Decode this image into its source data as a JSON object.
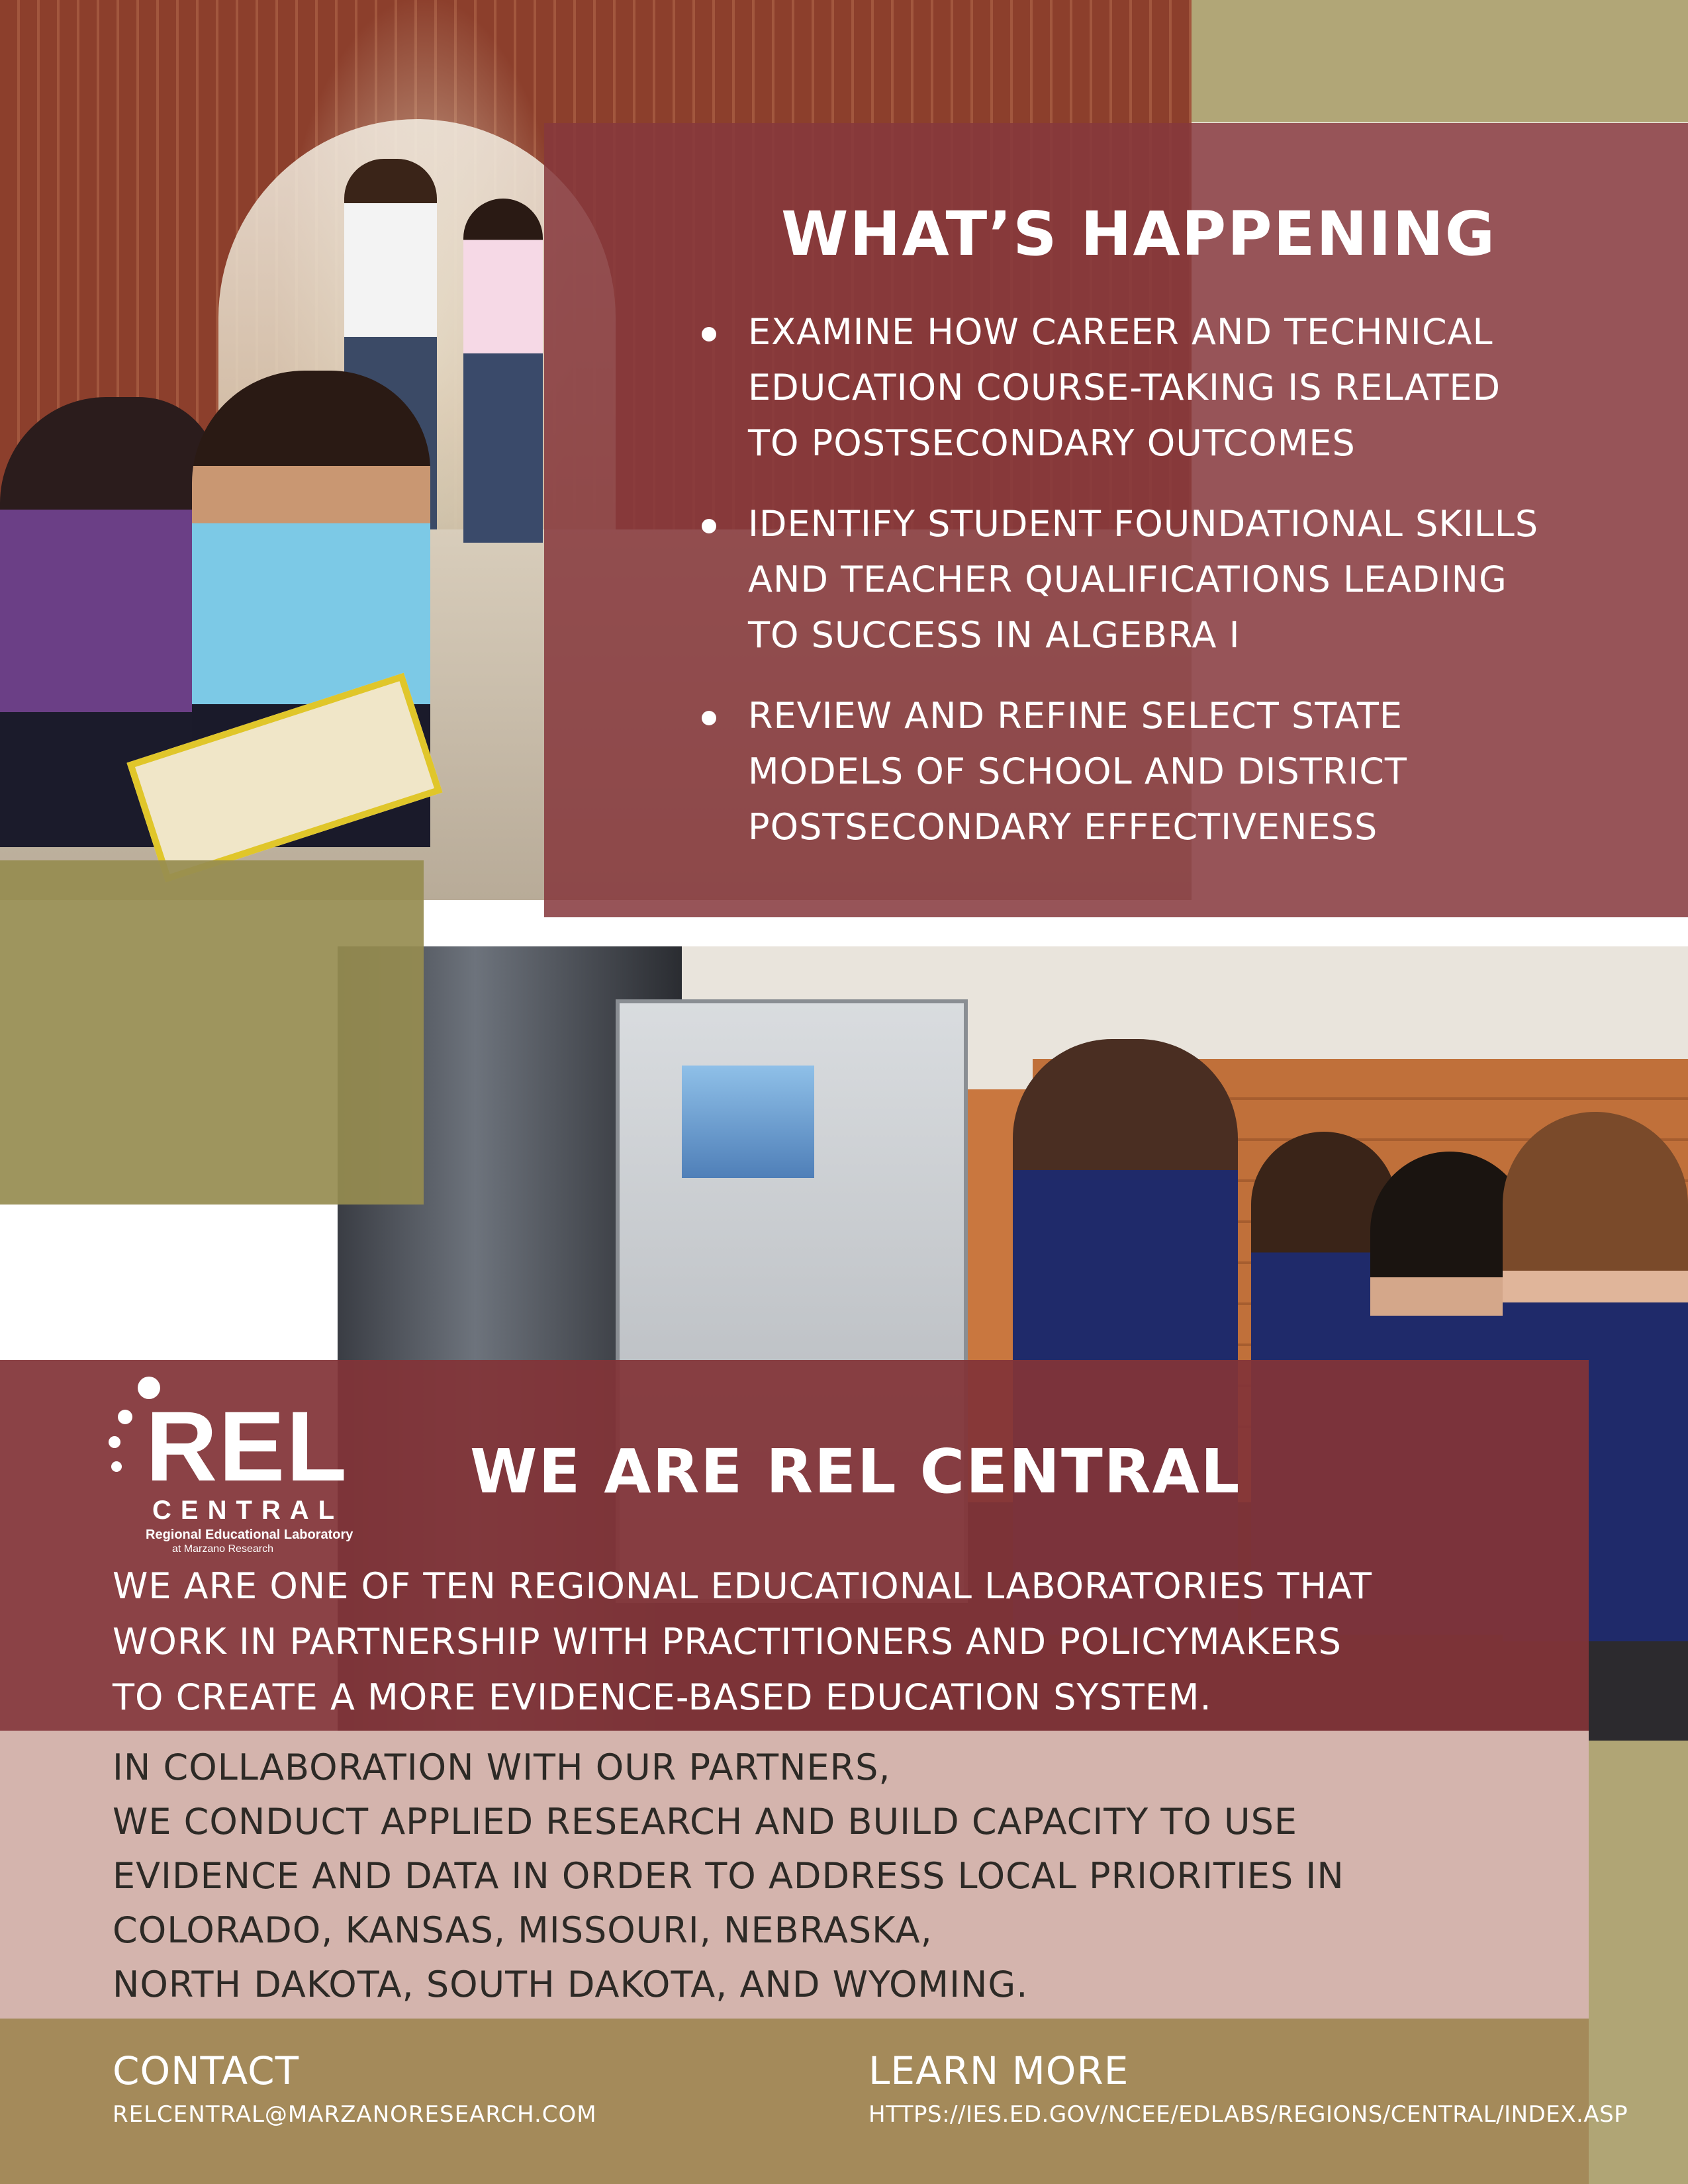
{
  "colors": {
    "maroon": "#86383c",
    "olive": "#b1a677",
    "pink": "#d4b4ad",
    "gold": "#a48a5a",
    "text_light": "#ffffff",
    "text_dark": "#2d2a26"
  },
  "whats_happening": {
    "title": "WHAT’S HAPPENING",
    "items": [
      "EXAMINE HOW CAREER AND TECHNICAL EDUCATION COURSE-TAKING IS RELATED TO POSTSECONDARY OUTCOMES",
      "IDENTIFY STUDENT FOUNDATIONAL SKILLS AND TEACHER QUALIFICATIONS LEADING TO SUCCESS IN ALGEBRA I",
      "REVIEW AND REFINE SELECT STATE MODELS OF SCHOOL AND DISTRICT POSTSECONDARY EFFECTIVENESS"
    ]
  },
  "logo": {
    "main": "REL",
    "sub": "CENTRAL",
    "line1": "Regional Educational Laboratory",
    "line2": "at Marzano Research"
  },
  "about": {
    "title": "WE ARE REL CENTRAL",
    "intro_lines": [
      "WE ARE ONE OF TEN REGIONAL EDUCATIONAL LABORATORIES THAT",
      "WORK IN PARTNERSHIP WITH PRACTITIONERS AND POLICYMAKERS",
      "TO CREATE A MORE EVIDENCE-BASED EDUCATION SYSTEM."
    ],
    "detail_lines": [
      "IN COLLABORATION WITH OUR PARTNERS,",
      "WE CONDUCT APPLIED RESEARCH AND BUILD CAPACITY TO USE",
      "EVIDENCE AND DATA IN ORDER TO ADDRESS LOCAL PRIORITIES IN",
      "COLORADO, KANSAS, MISSOURI, NEBRASKA,",
      "NORTH DAKOTA, SOUTH DAKOTA, AND WYOMING."
    ]
  },
  "footer": {
    "contact_label": "CONTACT",
    "contact_email": "RELCENTRAL@MARZANORESEARCH.COM",
    "learn_label": "LEARN MORE",
    "learn_url": "HTTPS://IES.ED.GOV/NCEE/EDLABS/REGIONS/CENTRAL/INDEX.ASP"
  }
}
